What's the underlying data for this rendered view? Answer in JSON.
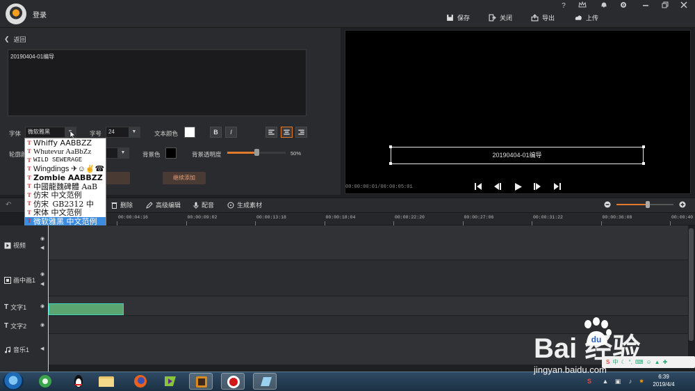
{
  "app": {
    "title": "登录"
  },
  "topbar": {
    "save": "保存",
    "close": "关闭",
    "export": "导出",
    "upload": "上传",
    "help": "?"
  },
  "editor": {
    "back": "返回",
    "text_value": "20190404-01编导",
    "font_label": "字体",
    "font_value": "微软雅黑",
    "size_label": "字号",
    "size_value": "24",
    "text_color_label": "文本颜色",
    "bold": "B",
    "italic": "I",
    "outline_label": "轮廓颜",
    "bg_color_label": "背景色",
    "bg_opacity_label": "背景透明度",
    "bg_opacity_value": "50%",
    "bg_opacity": 0.5,
    "continue_add": "继续添加",
    "text_color": "#ffffff",
    "bg_color": "#000000"
  },
  "font_list": [
    "Whiffy  AABBZZ",
    "Whutevur  AaBbZz",
    "WILD SEWERAGE",
    "Wingdings  ✈☺✌☎",
    "Zombie  AABBZZ",
    "中國龍魏碑體  AaB",
    "仿宋   中文范例",
    "仿宋_GB2312   中",
    "宋体   中文范例",
    "微软雅黑   中文范例"
  ],
  "preview": {
    "caption": "20190404-01编导",
    "timecode": "00:00:00:01/00:00:05:01"
  },
  "toolbar": {
    "delete": "删除",
    "advanced_edit": "高级编辑",
    "dub": "配音",
    "generate": "生成素材",
    "zoom": 0.55
  },
  "ruler": [
    "00:00:04:16",
    "00:00:09:02",
    "00:00:13:18",
    "00:00:18:04",
    "00:00:22:20",
    "00:00:27:06",
    "00:00:31:22",
    "00:00:36:08",
    "00:00:40"
  ],
  "tracks": [
    {
      "label": "视频",
      "icon": "video-icon"
    },
    {
      "label": "画中画1",
      "icon": "pip-icon"
    },
    {
      "label": "文字1",
      "icon": "text-icon"
    },
    {
      "label": "文字2",
      "icon": "text-icon"
    },
    {
      "label": "音乐1",
      "icon": "music-icon"
    }
  ],
  "taskbar": {
    "time": "6:39",
    "date": "2019/4/4"
  },
  "watermark": {
    "brand": "Bai  经验",
    "url": "jingyan.baidu.com"
  }
}
